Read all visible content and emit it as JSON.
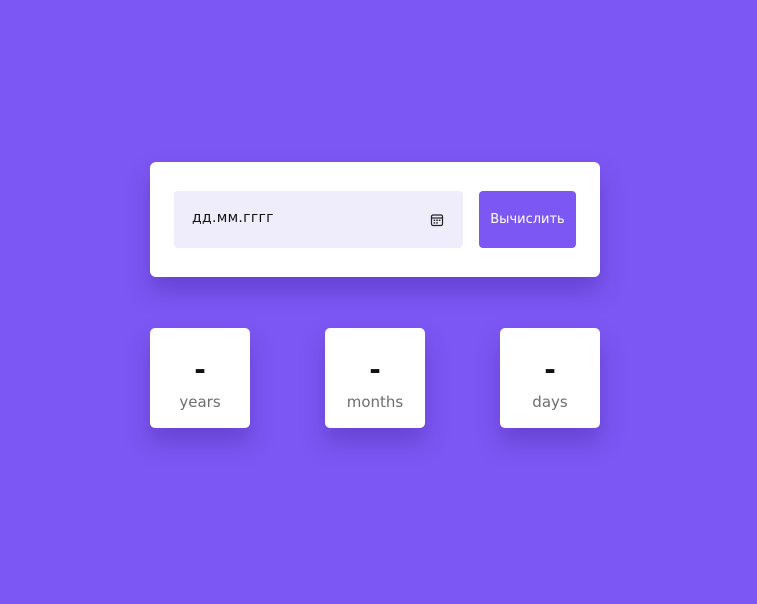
{
  "form": {
    "date_placeholder": "дд.мм.гггг",
    "calendar_icon": "calendar-icon",
    "calculate_label": "Вычислить"
  },
  "results": {
    "years": {
      "value": "-",
      "label": "years"
    },
    "months": {
      "value": "-",
      "label": "months"
    },
    "days": {
      "value": "-",
      "label": "days"
    }
  },
  "colors": {
    "background": "#7d57f3",
    "accent": "#7d57f3",
    "input_bg": "#efedfc",
    "card_bg": "#ffffff",
    "label_text": "#6e6e6e"
  }
}
